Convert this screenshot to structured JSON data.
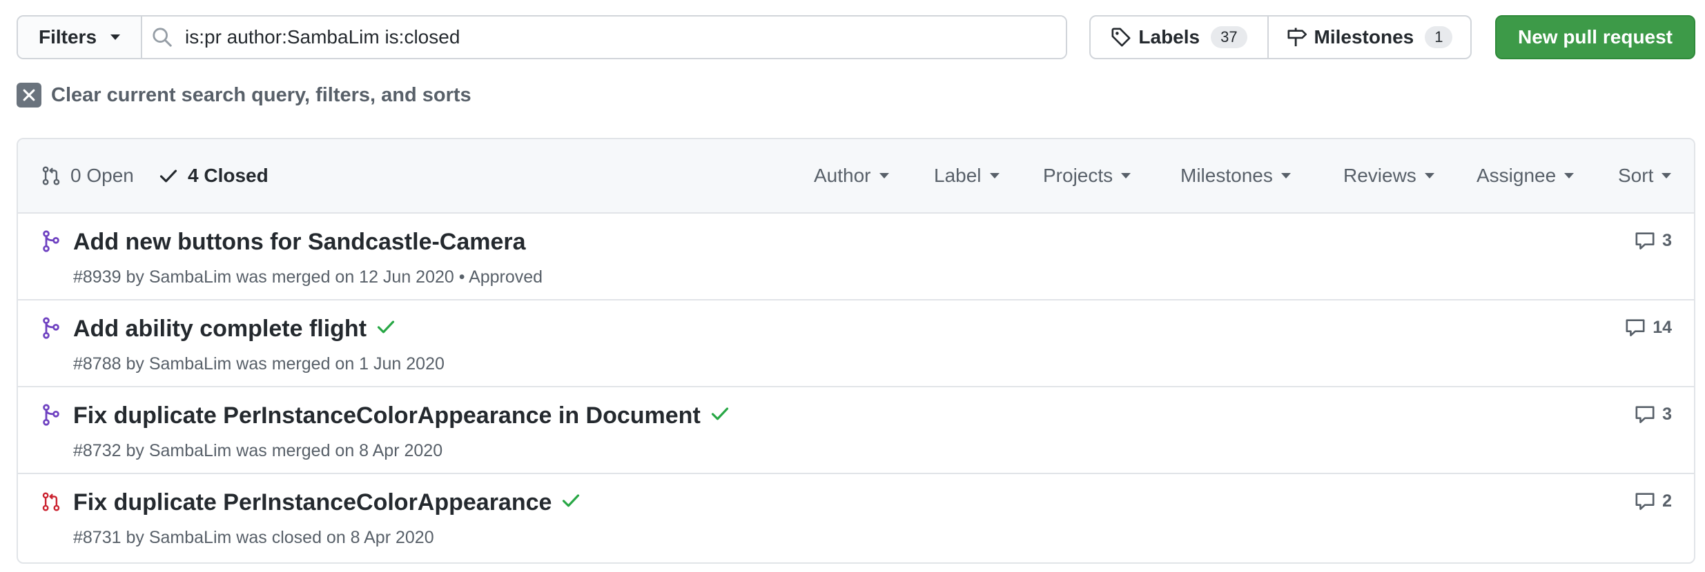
{
  "toolbar": {
    "filters_label": "Filters",
    "search_value": "is:pr author:SambaLim is:closed",
    "labels_label": "Labels",
    "labels_count": "37",
    "milestones_label": "Milestones",
    "milestones_count": "1",
    "new_pr_label": "New pull request",
    "accent_color": "#3d9a48"
  },
  "clear_query": "Clear current search query, filters, and sorts",
  "states": {
    "open_label": "0 Open",
    "closed_label": "4 Closed"
  },
  "filter_menus": [
    "Author",
    "Label",
    "Projects",
    "Milestones",
    "Reviews",
    "Assignee",
    "Sort"
  ],
  "pull_requests": [
    {
      "title": "Add new buttons for Sandcastle-Camera",
      "number": "#8939",
      "by": "by",
      "author": "SambaLim",
      "status_text": "was merged on 12 Jun 2020",
      "review": "• Approved",
      "comments": "3",
      "state": "merged",
      "check": false
    },
    {
      "title": "Add ability complete flight",
      "number": "#8788",
      "by": "by",
      "author": "SambaLim",
      "status_text": "was merged on 1 Jun 2020",
      "review": "",
      "comments": "14",
      "state": "merged",
      "check": true
    },
    {
      "title": "Fix duplicate PerInstanceColorAppearance in Document",
      "number": "#8732",
      "by": "by",
      "author": "SambaLim",
      "status_text": "was merged on 8 Apr 2020",
      "review": "",
      "comments": "3",
      "state": "merged",
      "check": true
    },
    {
      "title": "Fix duplicate PerInstanceColorAppearance",
      "number": "#8731",
      "by": "by",
      "author": "SambaLim",
      "status_text": "was closed on 8 Apr 2020",
      "review": "",
      "comments": "2",
      "state": "closed",
      "check": true
    }
  ],
  "colors": {
    "merged": "#6f42c1",
    "closed": "#cb2431",
    "check": "#28a745"
  }
}
